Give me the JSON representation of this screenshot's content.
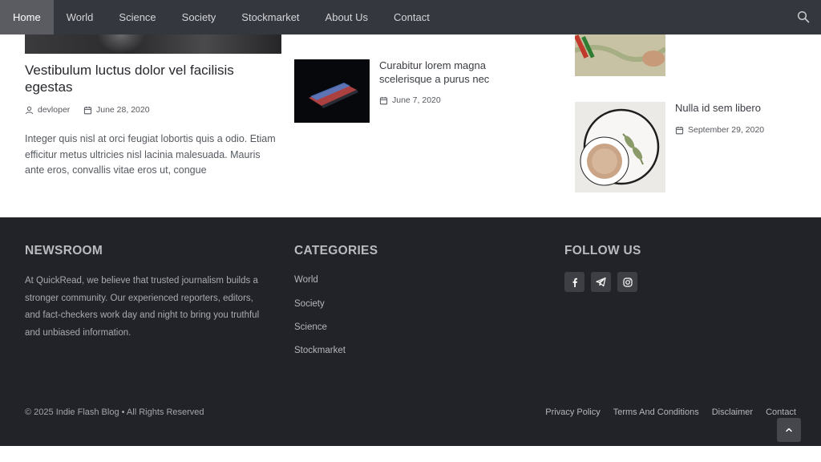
{
  "nav": {
    "items": [
      {
        "label": "Home"
      },
      {
        "label": "World"
      },
      {
        "label": "Science"
      },
      {
        "label": "Society"
      },
      {
        "label": "Stockmarket"
      },
      {
        "label": "About Us"
      },
      {
        "label": "Contact"
      }
    ],
    "active_index": 0,
    "search_icon": "search-icon"
  },
  "posts": {
    "featured": {
      "title": "Vestibulum luctus dolor vel facilisis egestas",
      "author": "devloper",
      "date": "June 28, 2020",
      "excerpt": "Integer quis nisl at orci feugiat lobortis quis a odio. Etiam efficitur metus ultricies nisl lacinia malesuada. Mauris ante eros, convallis vitae eros ut, congue"
    },
    "middle": {
      "title": "Curabitur lorem magna scelerisque a purus nec",
      "date": "June 7, 2020"
    },
    "right": {
      "title": "Nulla id sem libero",
      "date": "September 29, 2020"
    }
  },
  "footer": {
    "newsroom": {
      "heading": "NEWSROOM",
      "text": "At QuickRead, we believe that trusted journalism builds a stronger community. Our experienced reporters, editors, and fact-checkers work day and night to bring you truthful and unbiased information."
    },
    "categories": {
      "heading": "CATEGORIES",
      "items": [
        "World",
        "Society",
        "Science",
        "Stockmarket"
      ]
    },
    "follow": {
      "heading": "FOLLOW US",
      "icons": [
        "facebook-icon",
        "telegram-icon",
        "instagram-icon"
      ]
    },
    "copyright": "© 2025 Indie Flash Blog • All Rights Reserved",
    "links": [
      "Privacy Policy",
      "Terms And Conditions",
      "Disclaimer",
      "Contact"
    ]
  },
  "colors": {
    "nav_bg": "#35373e",
    "nav_active_bg": "#5a5c62",
    "footer_bg": "#222328"
  }
}
